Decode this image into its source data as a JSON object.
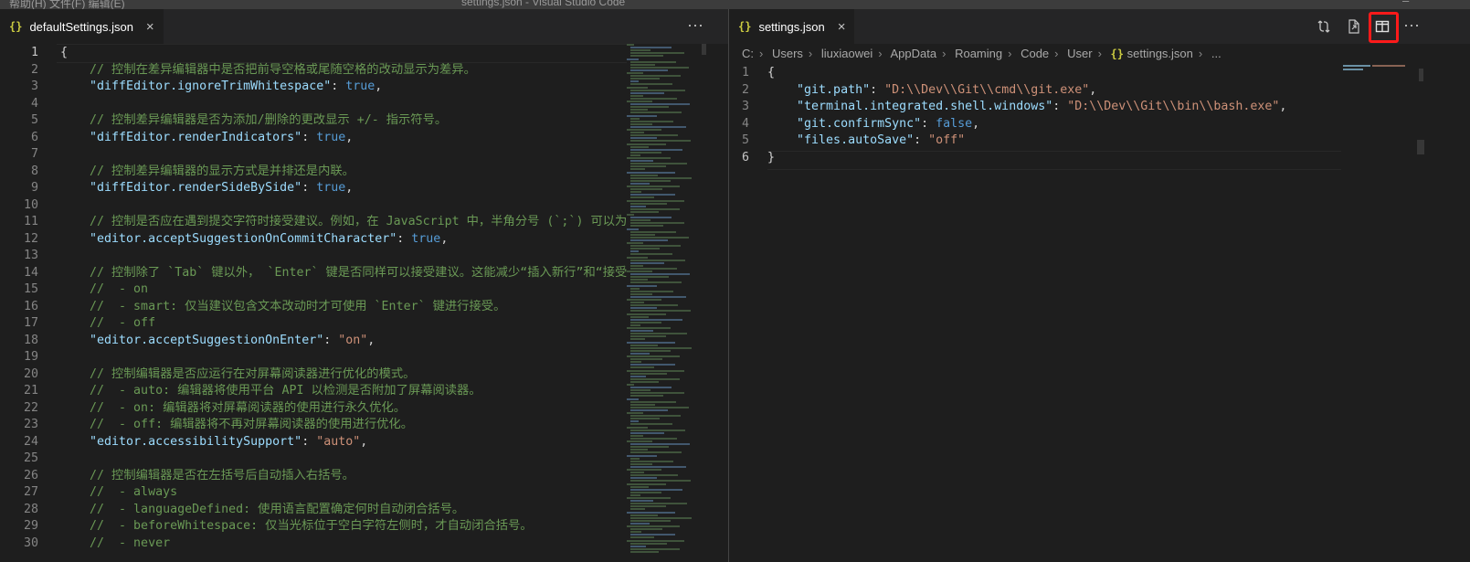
{
  "titlebar": {
    "menu": "帮助(H)    文件(F)    编辑(E)",
    "title": "settings.json - Visual Studio Code",
    "window_controls": "—"
  },
  "left": {
    "tab": {
      "label": "defaultSettings.json",
      "icon": "{}",
      "close": "×"
    },
    "more": "···",
    "lines": [
      {
        "n": "1",
        "parts": [
          [
            "p",
            "{"
          ]
        ]
      },
      {
        "n": "2",
        "parts": [
          [
            "c",
            "    // 控制在差异编辑器中是否把前导空格或尾随空格的改动显示为差异。"
          ]
        ]
      },
      {
        "n": "3",
        "parts": [
          [
            "p",
            "    "
          ],
          [
            "k",
            "\"diffEditor.ignoreTrimWhitespace\""
          ],
          [
            "p",
            ": "
          ],
          [
            "b",
            "true"
          ],
          [
            "p",
            ","
          ]
        ]
      },
      {
        "n": "4",
        "parts": []
      },
      {
        "n": "5",
        "parts": [
          [
            "c",
            "    // 控制差异编辑器是否为添加/删除的更改显示 +/- 指示符号。"
          ]
        ]
      },
      {
        "n": "6",
        "parts": [
          [
            "p",
            "    "
          ],
          [
            "k",
            "\"diffEditor.renderIndicators\""
          ],
          [
            "p",
            ": "
          ],
          [
            "b",
            "true"
          ],
          [
            "p",
            ","
          ]
        ]
      },
      {
        "n": "7",
        "parts": []
      },
      {
        "n": "8",
        "parts": [
          [
            "c",
            "    // 控制差异编辑器的显示方式是并排还是内联。"
          ]
        ]
      },
      {
        "n": "9",
        "parts": [
          [
            "p",
            "    "
          ],
          [
            "k",
            "\"diffEditor.renderSideBySide\""
          ],
          [
            "p",
            ": "
          ],
          [
            "b",
            "true"
          ],
          [
            "p",
            ","
          ]
        ]
      },
      {
        "n": "10",
        "parts": []
      },
      {
        "n": "11",
        "parts": [
          [
            "c",
            "    // 控制是否应在遇到提交字符时接受建议。例如，在 JavaScript 中，半角分号 (`;`) 可以为"
          ]
        ]
      },
      {
        "n": "12",
        "parts": [
          [
            "p",
            "    "
          ],
          [
            "k",
            "\"editor.acceptSuggestionOnCommitCharacter\""
          ],
          [
            "p",
            ": "
          ],
          [
            "b",
            "true"
          ],
          [
            "p",
            ","
          ]
        ]
      },
      {
        "n": "13",
        "parts": []
      },
      {
        "n": "14",
        "parts": [
          [
            "c",
            "    // 控制除了 `Tab` 键以外， `Enter` 键是否同样可以接受建议。这能减少“插入新行”和“接受"
          ]
        ]
      },
      {
        "n": "15",
        "parts": [
          [
            "c",
            "    //  - on"
          ]
        ]
      },
      {
        "n": "16",
        "parts": [
          [
            "c",
            "    //  - smart: 仅当建议包含文本改动时才可使用 `Enter` 键进行接受。"
          ]
        ]
      },
      {
        "n": "17",
        "parts": [
          [
            "c",
            "    //  - off"
          ]
        ]
      },
      {
        "n": "18",
        "parts": [
          [
            "p",
            "    "
          ],
          [
            "k",
            "\"editor.acceptSuggestionOnEnter\""
          ],
          [
            "p",
            ": "
          ],
          [
            "s",
            "\"on\""
          ],
          [
            "p",
            ","
          ]
        ]
      },
      {
        "n": "19",
        "parts": []
      },
      {
        "n": "20",
        "parts": [
          [
            "c",
            "    // 控制编辑器是否应运行在对屏幕阅读器进行优化的模式。"
          ]
        ]
      },
      {
        "n": "21",
        "parts": [
          [
            "c",
            "    //  - auto: 编辑器将使用平台 API 以检测是否附加了屏幕阅读器。"
          ]
        ]
      },
      {
        "n": "22",
        "parts": [
          [
            "c",
            "    //  - on: 编辑器将对屏幕阅读器的使用进行永久优化。"
          ]
        ]
      },
      {
        "n": "23",
        "parts": [
          [
            "c",
            "    //  - off: 编辑器将不再对屏幕阅读器的使用进行优化。"
          ]
        ]
      },
      {
        "n": "24",
        "parts": [
          [
            "p",
            "    "
          ],
          [
            "k",
            "\"editor.accessibilitySupport\""
          ],
          [
            "p",
            ": "
          ],
          [
            "s",
            "\"auto\""
          ],
          [
            "p",
            ","
          ]
        ]
      },
      {
        "n": "25",
        "parts": []
      },
      {
        "n": "26",
        "parts": [
          [
            "c",
            "    // 控制编辑器是否在左括号后自动插入右括号。"
          ]
        ]
      },
      {
        "n": "27",
        "parts": [
          [
            "c",
            "    //  - always"
          ]
        ]
      },
      {
        "n": "28",
        "parts": [
          [
            "c",
            "    //  - languageDefined: 使用语言配置确定何时自动闭合括号。"
          ]
        ]
      },
      {
        "n": "29",
        "parts": [
          [
            "c",
            "    //  - beforeWhitespace: 仅当光标位于空白字符左侧时，才自动闭合括号。"
          ]
        ]
      },
      {
        "n": "30",
        "parts": [
          [
            "c",
            "    //  - never"
          ]
        ]
      }
    ]
  },
  "right": {
    "tab": {
      "label": "settings.json",
      "icon": "{}",
      "close": "×"
    },
    "breadcrumb": [
      "C:",
      "Users",
      "liuxiaowei",
      "AppData",
      "Roaming",
      "Code",
      "User",
      "settings.json",
      "..."
    ],
    "breadcrumb_file_icon": "{}",
    "actions": {
      "compare": "compare-changes-icon",
      "open_file": "open-file-icon",
      "split": "split-editor-icon",
      "more": "···"
    },
    "lines": [
      {
        "n": "1",
        "parts": [
          [
            "p",
            "{"
          ]
        ]
      },
      {
        "n": "2",
        "parts": [
          [
            "p",
            "    "
          ],
          [
            "k",
            "\"git.path\""
          ],
          [
            "p",
            ": "
          ],
          [
            "s",
            "\"D:\\\\Dev\\\\Git\\\\cmd\\\\git.exe\""
          ],
          [
            "p",
            ","
          ]
        ]
      },
      {
        "n": "3",
        "parts": [
          [
            "p",
            "    "
          ],
          [
            "k",
            "\"terminal.integrated.shell.windows\""
          ],
          [
            "p",
            ": "
          ],
          [
            "s",
            "\"D:\\\\Dev\\\\Git\\\\bin\\\\bash.exe\""
          ],
          [
            "p",
            ","
          ]
        ]
      },
      {
        "n": "4",
        "parts": [
          [
            "p",
            "    "
          ],
          [
            "k",
            "\"git.confirmSync\""
          ],
          [
            "p",
            ": "
          ],
          [
            "b",
            "false"
          ],
          [
            "p",
            ","
          ]
        ]
      },
      {
        "n": "5",
        "parts": [
          [
            "p",
            "    "
          ],
          [
            "k",
            "\"files.autoSave\""
          ],
          [
            "p",
            ": "
          ],
          [
            "s",
            "\"off\""
          ]
        ]
      },
      {
        "n": "6",
        "parts": [
          [
            "p",
            "}"
          ]
        ]
      }
    ]
  },
  "colors": {
    "key": "#9cdcfe",
    "string": "#ce9178",
    "boolean": "#569cd6",
    "comment": "#6a9955",
    "highlight": "#ff1a1a"
  }
}
